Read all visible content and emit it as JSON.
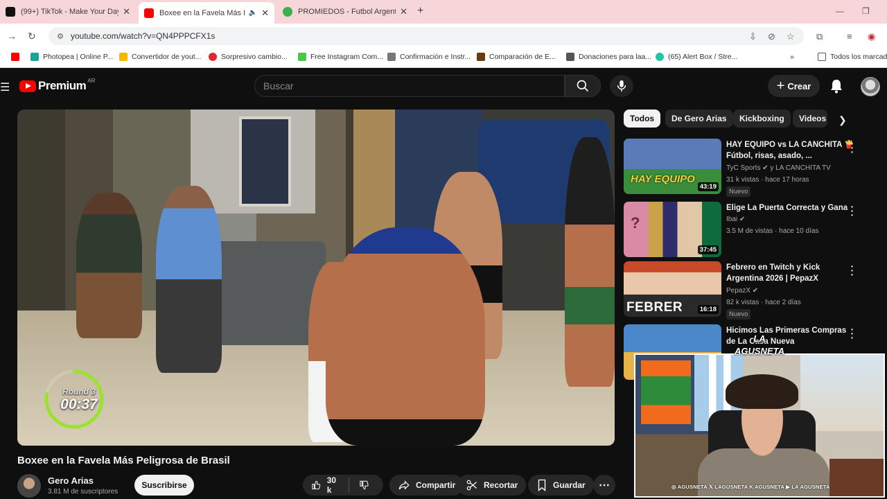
{
  "browser": {
    "tabs": [
      {
        "title": "(99+) TikTok - Make Your Day",
        "color": "#111111"
      },
      {
        "title": "Boxee en la Favela Más Peli",
        "color": "#ff0000"
      },
      {
        "title": "PROMIEDOS - Futbol Argentin",
        "color": "#3cae4a"
      }
    ],
    "url": "youtube.com/watch?v=QN4PPPCFX1s",
    "bookmarks": [
      {
        "label": "",
        "color": "#ff0000"
      },
      {
        "label": "Photopea | Online P...",
        "color": "#18a497"
      },
      {
        "label": "Convertidor de yout...",
        "color": "#f5b800"
      },
      {
        "label": "Sorpresivo cambio...",
        "color": "#e0282e"
      },
      {
        "label": "Free Instagram Com...",
        "color": "#49c74a"
      },
      {
        "label": "Confirmación e Instr...",
        "color": "#777777"
      },
      {
        "label": "Comparación de E...",
        "color": "#6a3a12"
      },
      {
        "label": "Donaciones para laa...",
        "color": "#555555"
      },
      {
        "label": "(65) Alert Box / Stre...",
        "color": "#23c4a4"
      }
    ],
    "bookmarks_folder": "Todos los marcad"
  },
  "youtube": {
    "brand": "Premium",
    "region": "AR",
    "search_placeholder": "Buscar",
    "create_label": "Crear",
    "video": {
      "round_label": "Round 3",
      "round_time": "00:37",
      "round_progress": 0.78
    },
    "title": "Boxee en la Favela Más Peligrosa de Brasil",
    "channel": "Gero Arias",
    "subscribers": "3.81 M de suscriptores",
    "subscribe_label": "Suscribirse",
    "likes": "30 k",
    "share_label": "Compartir",
    "clip_label": "Recortar",
    "save_label": "Guardar"
  },
  "sidebar": {
    "chips": [
      "Todos",
      "De Gero Arias",
      "Kickboxing",
      "Videos"
    ],
    "recommendations": [
      {
        "title": "HAY EQUIPO vs LA CANCHITA 🍟 Fútbol, risas, asado, ...",
        "channel": "TyC Sports ✔ y LA CANCHITA TV",
        "meta": "31 k vistas · hace 17 horas",
        "badge": "Nuevo",
        "duration": "43:19",
        "thumb_colors": [
          "#3a8d3a",
          "#f4d23c"
        ]
      },
      {
        "title": "Elige La Puerta Correcta y Gana",
        "channel": "Ibai ✔",
        "meta": "3.5 M de vistas · hace 10 días",
        "badge": "",
        "duration": "37:45",
        "thumb_colors": [
          "#d98aa4",
          "#0e6b3c"
        ]
      },
      {
        "title": "Febrero en Twitch y Kick Argentina 2026 | PepazX",
        "channel": "PepazX ✔",
        "meta": "82 k vistas · hace 2 días",
        "badge": "Nuevo",
        "duration": "16:18",
        "thumb_colors": [
          "#c94a2a",
          "#2a6fc9"
        ]
      },
      {
        "title": "Hicimos Las Primeras Compras de La Casa Nueva",
        "channel": "",
        "meta": "",
        "badge": "",
        "duration": "",
        "thumb_colors": [
          "#4a88c9",
          "#e6b34a"
        ]
      }
    ]
  },
  "webcam": {
    "logo_text": "LA AGUSNETA",
    "socials": "◎ AGUSNETA  𝕏 LAGUSNETA  K AGUSNETA  ▶ LA AGUSNETA"
  }
}
